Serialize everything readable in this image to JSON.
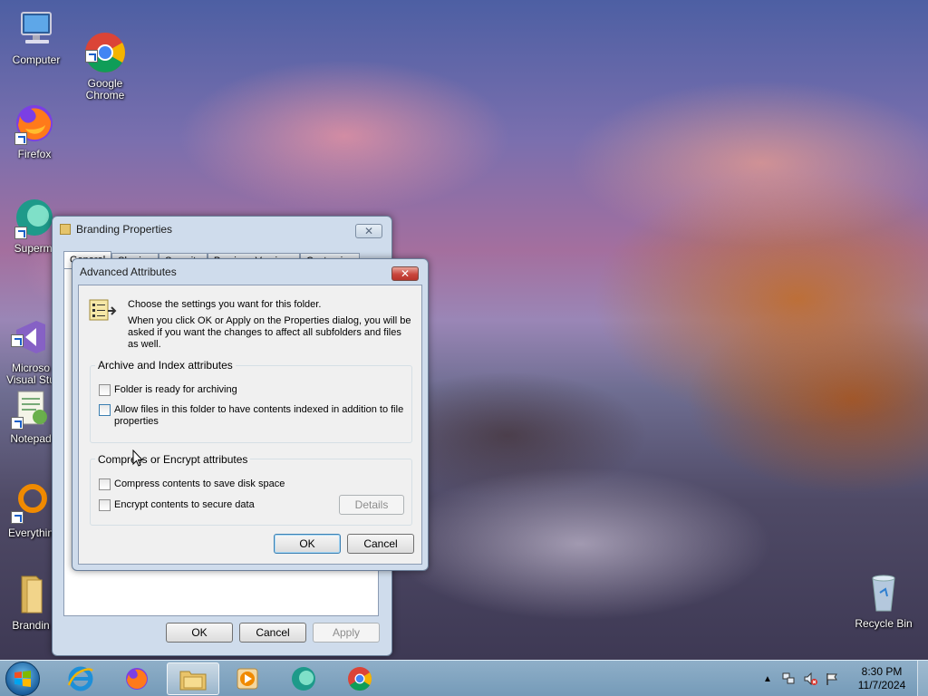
{
  "desktop": {
    "icons": [
      {
        "label": "Computer"
      },
      {
        "label": "Google\nChrome"
      },
      {
        "label": "Firefox"
      },
      {
        "label": "Supermi"
      },
      {
        "label": "Microso\nVisual Stu"
      },
      {
        "label": "Notepad"
      },
      {
        "label": "Everythin"
      },
      {
        "label": "Brandin"
      },
      {
        "label": "Recycle Bin"
      }
    ]
  },
  "properties_window": {
    "title": "Branding Properties",
    "tabs": [
      "General",
      "Sharing",
      "Security",
      "Previous Versions",
      "Customize"
    ],
    "ok_label": "OK",
    "cancel_label": "Cancel",
    "apply_label": "Apply"
  },
  "advanced_dialog": {
    "title": "Advanced Attributes",
    "intro": "Choose the settings you want for this folder.",
    "note": "When you click OK or Apply on the Properties dialog, you will be asked if you want the changes to affect all subfolders and files as well.",
    "archive_group": {
      "label": "Archive and Index attributes",
      "archive_option": "Folder is ready for archiving",
      "index_option": "Allow files in this folder to have contents indexed in addition to file properties"
    },
    "compress_group": {
      "label": "Compress or Encrypt attributes",
      "compress_option": "Compress contents to save disk space",
      "encrypt_option": "Encrypt contents to secure data",
      "details_label": "Details"
    },
    "ok_label": "OK",
    "cancel_label": "Cancel"
  },
  "taskbar": {
    "time": "8:30 PM",
    "date": "11/7/2024"
  },
  "colors": {
    "accent": "#3c7fb1",
    "close_button": "#c9463d",
    "taskbar": "#8fb4cf"
  }
}
